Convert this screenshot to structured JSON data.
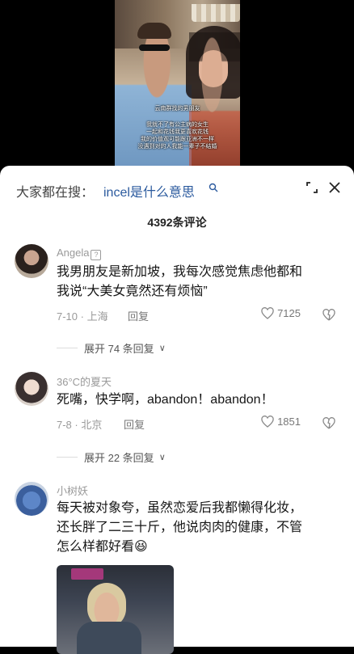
{
  "video": {
    "subtitles": [
      "云南群找的男朋友",
      "我就不了有公主病的女生",
      "一起和花钱我更喜欢花钱",
      "我的价值观可能跟亚洲不一样",
      "没遇到对的人我能一辈子不结婚"
    ]
  },
  "search": {
    "prefix": "大家都在搜：",
    "query": "incel是什么意思"
  },
  "comments_count": "4392条评论",
  "comments": [
    {
      "username": "Angela",
      "badge": "?",
      "lines": [
        "我男朋友是新加坡，我每次感觉焦虑他都和",
        "我说“大美女竟然还有烦恼”"
      ],
      "meta": "7-10 · 上海",
      "reply": "回复",
      "likes": "7125",
      "expand": "展开 74 条回复"
    },
    {
      "username": "36°C的夏天",
      "lines": [
        "死嘴，快学啊，abandon！abandon！"
      ],
      "meta": "7-8 · 北京",
      "reply": "回复",
      "likes": "1851",
      "expand": "展开 22 条回复"
    },
    {
      "username": "小树妖",
      "lines": [
        "每天被对象夸，虽然恋爱后我都懒得化妆，",
        "还长胖了二三十斤，他说肉肉的健康，不管",
        "怎么样都好看😆"
      ]
    }
  ]
}
